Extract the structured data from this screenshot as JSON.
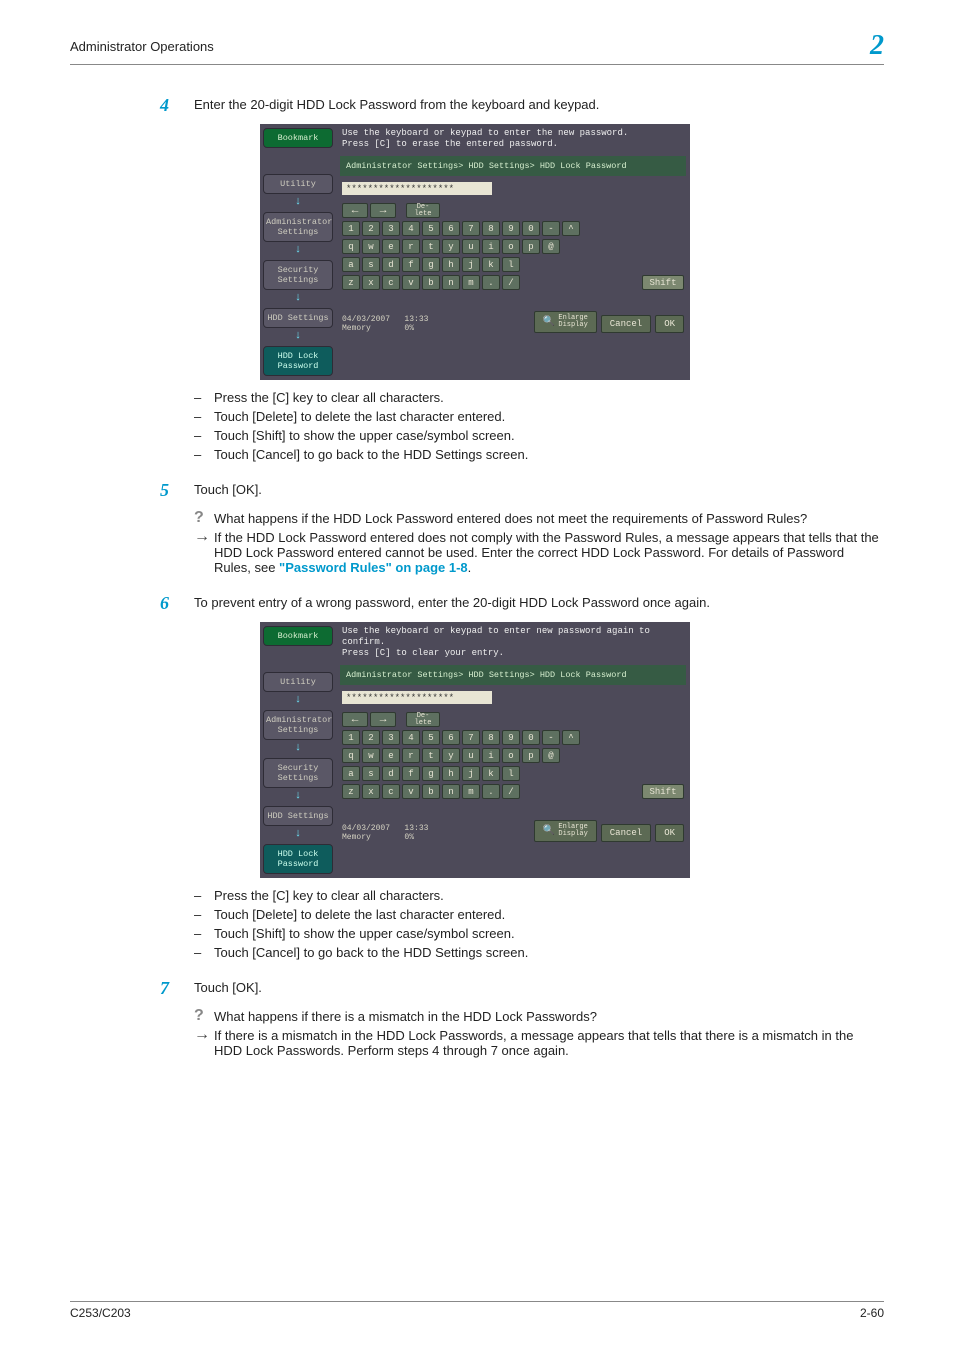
{
  "header": {
    "title": "Administrator Operations",
    "chapter": "2"
  },
  "footer": {
    "left": "C253/C203",
    "right": "2-60"
  },
  "steps": {
    "s4": {
      "num": "4",
      "text": "Enter the 20-digit HDD Lock Password from the keyboard and keypad."
    },
    "s5": {
      "num": "5",
      "text": "Touch [OK]."
    },
    "s5q": "What happens if the HDD Lock Password entered does not meet the requirements of Password Rules?",
    "s5a_pre": "If the HDD Lock Password entered does not comply with the Password Rules, a message appears that tells that the HDD Lock Password entered cannot be used. Enter the correct HDD Lock Password. For details of Password Rules, see ",
    "s5a_link": "\"Password Rules\" on page 1-8",
    "s5a_post": ".",
    "s6": {
      "num": "6",
      "text": "To prevent entry of a wrong password, enter the 20-digit HDD Lock Password once again."
    },
    "s7": {
      "num": "7",
      "text": "Touch [OK]."
    },
    "s7q": "What happens if there is a mismatch in the HDD Lock Passwords?",
    "s7a": "If there is a mismatch in the HDD Lock Passwords, a message appears that tells that there is a mismatch in the HDD Lock Passwords. Perform steps 4 through 7 once again."
  },
  "bullets": {
    "b1": "Press the [C] key to clear all characters.",
    "b2": "Touch [Delete] to delete the last character entered.",
    "b3": "Touch [Shift] to show the upper case/symbol screen.",
    "b4": "Touch [Cancel] to go back to the HDD Settings screen."
  },
  "shot": {
    "inst1": "Use the keyboard or keypad to enter the new password.\nPress [C] to erase the entered password.",
    "inst2": "Use the keyboard or keypad to enter new password again to confirm.\nPress [C] to clear your entry.",
    "breadcrumb": "Administrator Settings> HDD Settings> HDD Lock Password",
    "passwordMask": "********************",
    "side": {
      "bookmark": "Bookmark",
      "utility": "Utility",
      "admin": "Administrator\nSettings",
      "security": "Security\nSettings",
      "hdd": "HDD Settings",
      "hddlock": "HDD Lock\nPassword"
    },
    "keys": {
      "left": "←",
      "right": "→",
      "delete": "De-\nlete",
      "row1": [
        "1",
        "2",
        "3",
        "4",
        "5",
        "6",
        "7",
        "8",
        "9",
        "0",
        "-",
        "^"
      ],
      "row2": [
        "q",
        "w",
        "e",
        "r",
        "t",
        "y",
        "u",
        "i",
        "o",
        "p",
        "@"
      ],
      "row3": [
        "a",
        "s",
        "d",
        "f",
        "g",
        "h",
        "j",
        "k",
        "l"
      ],
      "row4": [
        "z",
        "x",
        "c",
        "v",
        "b",
        "n",
        "m",
        ".",
        "/"
      ],
      "shift": "Shift"
    },
    "bottom": {
      "date": "04/03/2007",
      "time": "13:33",
      "memLabel": "Memory",
      "memVal": "0%",
      "enlarge": "Enlarge\nDisplay",
      "cancel": "Cancel",
      "ok": "OK"
    }
  }
}
